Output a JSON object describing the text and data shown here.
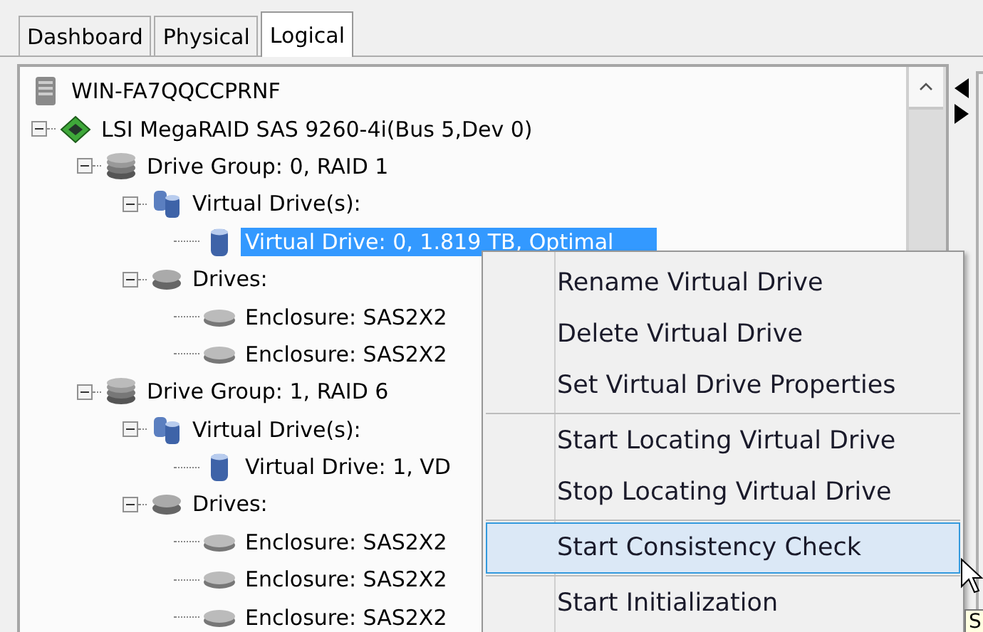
{
  "tabs": [
    {
      "label": "Dashboard",
      "selected": false
    },
    {
      "label": "Physical",
      "selected": false
    },
    {
      "label": "Logical",
      "selected": true
    }
  ],
  "tree": [
    {
      "kind": "server",
      "label": "WIN-FA7QQCCPRNF",
      "selected": false,
      "children": [
        {
          "kind": "controller",
          "label": "LSI MegaRAID SAS 9260-4i(Bus 5,Dev 0)",
          "selected": false,
          "expanded": true,
          "children": [
            {
              "kind": "group",
              "label": "Drive Group: 0, RAID  1",
              "selected": false,
              "expanded": true,
              "children": [
                {
                  "kind": "vdrives",
                  "label": "Virtual Drive(s):",
                  "selected": false,
                  "expanded": true,
                  "children": [
                    {
                      "kind": "vdrive",
                      "label": "Virtual Drive: 0, 1.819 TB, Optimal",
                      "selected": true
                    }
                  ]
                },
                {
                  "kind": "drives",
                  "label": "Drives:",
                  "selected": false,
                  "expanded": true,
                  "children": [
                    {
                      "kind": "disk",
                      "label": "Enclosure: SAS2X2",
                      "selected": false
                    },
                    {
                      "kind": "disk",
                      "label": "Enclosure: SAS2X2",
                      "selected": false
                    }
                  ]
                }
              ]
            },
            {
              "kind": "group",
              "label": "Drive Group: 1, RAID  6",
              "selected": false,
              "expanded": true,
              "children": [
                {
                  "kind": "vdrives",
                  "label": "Virtual Drive(s):",
                  "selected": false,
                  "expanded": true,
                  "children": [
                    {
                      "kind": "vdrive",
                      "label": "Virtual Drive: 1, VD",
                      "selected": false
                    }
                  ]
                },
                {
                  "kind": "drives",
                  "label": "Drives:",
                  "selected": false,
                  "expanded": true,
                  "children": [
                    {
                      "kind": "disk",
                      "label": "Enclosure: SAS2X2",
                      "selected": false
                    },
                    {
                      "kind": "disk",
                      "label": "Enclosure: SAS2X2",
                      "selected": false
                    },
                    {
                      "kind": "disk",
                      "label": "Enclosure: SAS2X2",
                      "selected": false
                    }
                  ]
                }
              ]
            }
          ]
        }
      ]
    }
  ],
  "context_menu": {
    "groups": [
      [
        {
          "label": "Rename Virtual Drive",
          "selected": false
        },
        {
          "label": "Delete Virtual Drive",
          "selected": false
        },
        {
          "label": "Set Virtual Drive Properties",
          "selected": false
        }
      ],
      [
        {
          "label": "Start Locating Virtual Drive",
          "selected": false
        },
        {
          "label": "Stop Locating Virtual Drive",
          "selected": false
        }
      ],
      [
        {
          "label": "Start Consistency Check",
          "selected": true
        }
      ],
      [
        {
          "label": "Start Initialization",
          "selected": false
        }
      ]
    ]
  },
  "tooltip": {
    "text": "S"
  }
}
